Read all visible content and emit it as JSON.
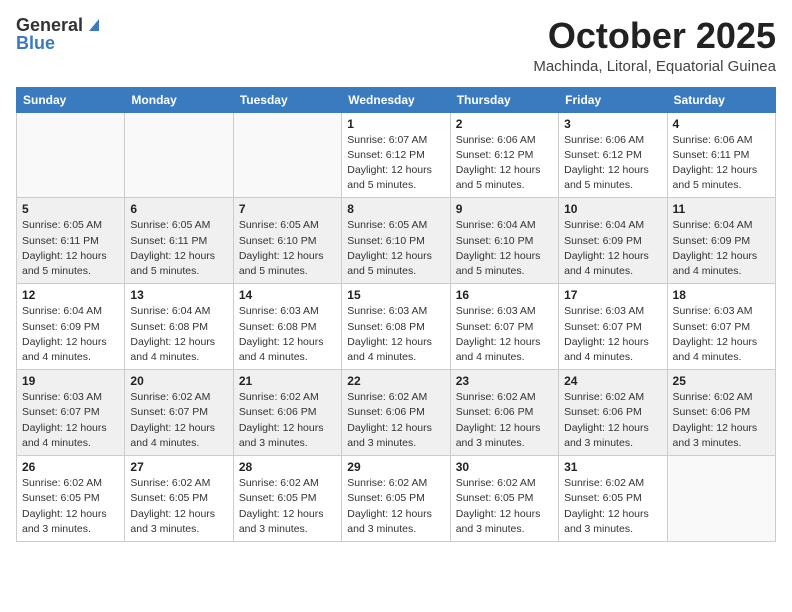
{
  "logo": {
    "general": "General",
    "blue": "Blue"
  },
  "header": {
    "month": "October 2025",
    "location": "Machinda, Litoral, Equatorial Guinea"
  },
  "weekdays": [
    "Sunday",
    "Monday",
    "Tuesday",
    "Wednesday",
    "Thursday",
    "Friday",
    "Saturday"
  ],
  "weeks": [
    [
      {
        "day": "",
        "info": ""
      },
      {
        "day": "",
        "info": ""
      },
      {
        "day": "",
        "info": ""
      },
      {
        "day": "1",
        "info": "Sunrise: 6:07 AM\nSunset: 6:12 PM\nDaylight: 12 hours\nand 5 minutes."
      },
      {
        "day": "2",
        "info": "Sunrise: 6:06 AM\nSunset: 6:12 PM\nDaylight: 12 hours\nand 5 minutes."
      },
      {
        "day": "3",
        "info": "Sunrise: 6:06 AM\nSunset: 6:12 PM\nDaylight: 12 hours\nand 5 minutes."
      },
      {
        "day": "4",
        "info": "Sunrise: 6:06 AM\nSunset: 6:11 PM\nDaylight: 12 hours\nand 5 minutes."
      }
    ],
    [
      {
        "day": "5",
        "info": "Sunrise: 6:05 AM\nSunset: 6:11 PM\nDaylight: 12 hours\nand 5 minutes."
      },
      {
        "day": "6",
        "info": "Sunrise: 6:05 AM\nSunset: 6:11 PM\nDaylight: 12 hours\nand 5 minutes."
      },
      {
        "day": "7",
        "info": "Sunrise: 6:05 AM\nSunset: 6:10 PM\nDaylight: 12 hours\nand 5 minutes."
      },
      {
        "day": "8",
        "info": "Sunrise: 6:05 AM\nSunset: 6:10 PM\nDaylight: 12 hours\nand 5 minutes."
      },
      {
        "day": "9",
        "info": "Sunrise: 6:04 AM\nSunset: 6:10 PM\nDaylight: 12 hours\nand 5 minutes."
      },
      {
        "day": "10",
        "info": "Sunrise: 6:04 AM\nSunset: 6:09 PM\nDaylight: 12 hours\nand 4 minutes."
      },
      {
        "day": "11",
        "info": "Sunrise: 6:04 AM\nSunset: 6:09 PM\nDaylight: 12 hours\nand 4 minutes."
      }
    ],
    [
      {
        "day": "12",
        "info": "Sunrise: 6:04 AM\nSunset: 6:09 PM\nDaylight: 12 hours\nand 4 minutes."
      },
      {
        "day": "13",
        "info": "Sunrise: 6:04 AM\nSunset: 6:08 PM\nDaylight: 12 hours\nand 4 minutes."
      },
      {
        "day": "14",
        "info": "Sunrise: 6:03 AM\nSunset: 6:08 PM\nDaylight: 12 hours\nand 4 minutes."
      },
      {
        "day": "15",
        "info": "Sunrise: 6:03 AM\nSunset: 6:08 PM\nDaylight: 12 hours\nand 4 minutes."
      },
      {
        "day": "16",
        "info": "Sunrise: 6:03 AM\nSunset: 6:07 PM\nDaylight: 12 hours\nand 4 minutes."
      },
      {
        "day": "17",
        "info": "Sunrise: 6:03 AM\nSunset: 6:07 PM\nDaylight: 12 hours\nand 4 minutes."
      },
      {
        "day": "18",
        "info": "Sunrise: 6:03 AM\nSunset: 6:07 PM\nDaylight: 12 hours\nand 4 minutes."
      }
    ],
    [
      {
        "day": "19",
        "info": "Sunrise: 6:03 AM\nSunset: 6:07 PM\nDaylight: 12 hours\nand 4 minutes."
      },
      {
        "day": "20",
        "info": "Sunrise: 6:02 AM\nSunset: 6:07 PM\nDaylight: 12 hours\nand 4 minutes."
      },
      {
        "day": "21",
        "info": "Sunrise: 6:02 AM\nSunset: 6:06 PM\nDaylight: 12 hours\nand 3 minutes."
      },
      {
        "day": "22",
        "info": "Sunrise: 6:02 AM\nSunset: 6:06 PM\nDaylight: 12 hours\nand 3 minutes."
      },
      {
        "day": "23",
        "info": "Sunrise: 6:02 AM\nSunset: 6:06 PM\nDaylight: 12 hours\nand 3 minutes."
      },
      {
        "day": "24",
        "info": "Sunrise: 6:02 AM\nSunset: 6:06 PM\nDaylight: 12 hours\nand 3 minutes."
      },
      {
        "day": "25",
        "info": "Sunrise: 6:02 AM\nSunset: 6:06 PM\nDaylight: 12 hours\nand 3 minutes."
      }
    ],
    [
      {
        "day": "26",
        "info": "Sunrise: 6:02 AM\nSunset: 6:05 PM\nDaylight: 12 hours\nand 3 minutes."
      },
      {
        "day": "27",
        "info": "Sunrise: 6:02 AM\nSunset: 6:05 PM\nDaylight: 12 hours\nand 3 minutes."
      },
      {
        "day": "28",
        "info": "Sunrise: 6:02 AM\nSunset: 6:05 PM\nDaylight: 12 hours\nand 3 minutes."
      },
      {
        "day": "29",
        "info": "Sunrise: 6:02 AM\nSunset: 6:05 PM\nDaylight: 12 hours\nand 3 minutes."
      },
      {
        "day": "30",
        "info": "Sunrise: 6:02 AM\nSunset: 6:05 PM\nDaylight: 12 hours\nand 3 minutes."
      },
      {
        "day": "31",
        "info": "Sunrise: 6:02 AM\nSunset: 6:05 PM\nDaylight: 12 hours\nand 3 minutes."
      },
      {
        "day": "",
        "info": ""
      }
    ]
  ]
}
